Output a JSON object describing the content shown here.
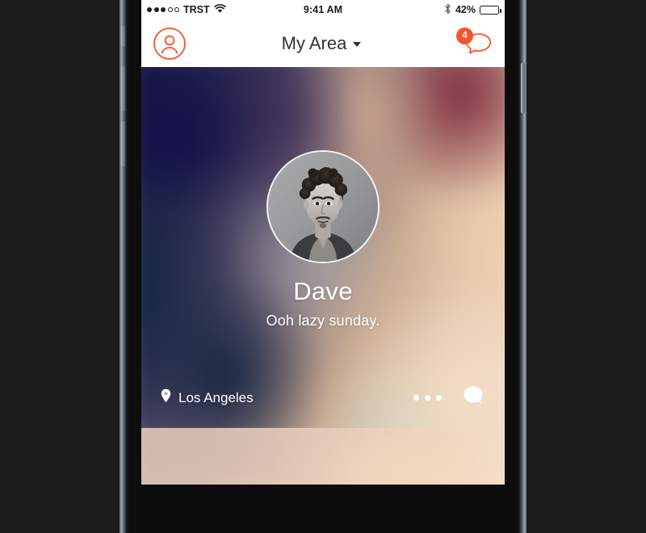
{
  "status_bar": {
    "signal_icon": "signal-dots",
    "signal_filled": 3,
    "signal_total": 5,
    "carrier": "TRST",
    "wifi_icon": "wifi-icon",
    "time": "9:41 AM",
    "bluetooth_icon": "bluetooth-icon",
    "battery_percent": "42%",
    "battery_level": 42
  },
  "nav_bar": {
    "profile_icon": "user-circle-icon",
    "title": "My Area",
    "caret_icon": "chevron-down-icon",
    "chat_icon": "speech-bubble-outline-icon",
    "unread_badge": "4"
  },
  "card": {
    "avatar_icon": "profile-photo",
    "name": "Dave",
    "status": "Ooh lazy sunday.",
    "location_icon": "map-pin-icon",
    "location": "Los Angeles",
    "more_icon": "more-dots-icon",
    "message_icon": "speech-bubble-filled-icon"
  },
  "colors": {
    "accent": "#f4572c",
    "nav_text": "#2f3133",
    "card_text": "#ffffff",
    "screen_bg": "#ffffff",
    "device_body": "#0d0d0d",
    "page_bg": "#1c1c1c"
  }
}
